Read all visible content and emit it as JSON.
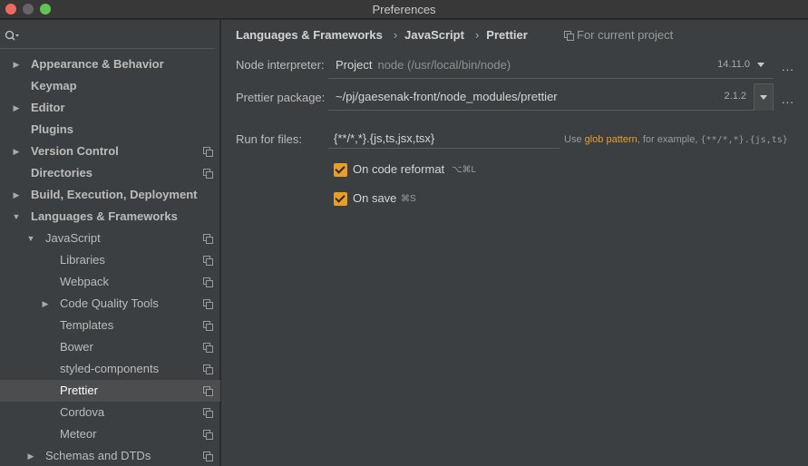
{
  "window": {
    "title": "Preferences"
  },
  "sidebar": {
    "items": [
      {
        "label": "Appearance & Behavior",
        "arrow": "▶",
        "bold": true,
        "copy": false
      },
      {
        "label": "Keymap",
        "arrow": "",
        "bold": true,
        "copy": false
      },
      {
        "label": "Editor",
        "arrow": "▶",
        "bold": true,
        "copy": false
      },
      {
        "label": "Plugins",
        "arrow": "",
        "bold": true,
        "copy": false
      },
      {
        "label": "Version Control",
        "arrow": "▶",
        "bold": true,
        "copy": true
      },
      {
        "label": "Directories",
        "arrow": "",
        "bold": true,
        "copy": true
      },
      {
        "label": "Build, Execution, Deployment",
        "arrow": "▶",
        "bold": true,
        "copy": false
      },
      {
        "label": "Languages & Frameworks",
        "arrow": "▼",
        "bold": true,
        "copy": false
      },
      {
        "label": "JavaScript",
        "arrow": "▼",
        "bold": false,
        "copy": true
      },
      {
        "label": "Libraries",
        "arrow": "",
        "bold": false,
        "copy": true
      },
      {
        "label": "Webpack",
        "arrow": "",
        "bold": false,
        "copy": true
      },
      {
        "label": "Code Quality Tools",
        "arrow": "▶",
        "bold": false,
        "copy": true
      },
      {
        "label": "Templates",
        "arrow": "",
        "bold": false,
        "copy": true
      },
      {
        "label": "Bower",
        "arrow": "",
        "bold": false,
        "copy": true
      },
      {
        "label": "styled-components",
        "arrow": "",
        "bold": false,
        "copy": true
      },
      {
        "label": "Prettier",
        "arrow": "",
        "bold": false,
        "copy": true,
        "selected": true
      },
      {
        "label": "Cordova",
        "arrow": "",
        "bold": false,
        "copy": true
      },
      {
        "label": "Meteor",
        "arrow": "",
        "bold": false,
        "copy": true
      },
      {
        "label": "Schemas and DTDs",
        "arrow": "▶",
        "bold": false,
        "copy": true
      }
    ]
  },
  "breadcrumb": [
    "Languages & Frameworks",
    "JavaScript",
    "Prettier"
  ],
  "breadcrumb_separator": "›",
  "scope_label": "For current project",
  "node_interpreter": {
    "label": "Node interpreter:",
    "value": "Project",
    "path": "node (/usr/local/bin/node)",
    "version": "14.11.0"
  },
  "prettier_package": {
    "label": "Prettier package:",
    "value": "~/pj/gaesenak-front/node_modules/prettier",
    "version": "2.1.2"
  },
  "more_label": "...",
  "run_for_files": {
    "label": "Run for files:",
    "value": "{**/*,*}.{js,ts,jsx,tsx}",
    "hint_prefix": "Use",
    "hint_link": "glob pattern",
    "hint_middle": ", for example,",
    "hint_example": "{**/*,*}.{js,ts}"
  },
  "on_code_reformat": {
    "label": "On code reformat",
    "shortcut": "⌥⌘L",
    "checked": true
  },
  "on_save": {
    "label": "On save",
    "shortcut": "⌘S",
    "checked": true
  },
  "colors": {
    "accent": "#e89e28",
    "background": "#3c3f41",
    "selection": "#4b4d4f"
  }
}
